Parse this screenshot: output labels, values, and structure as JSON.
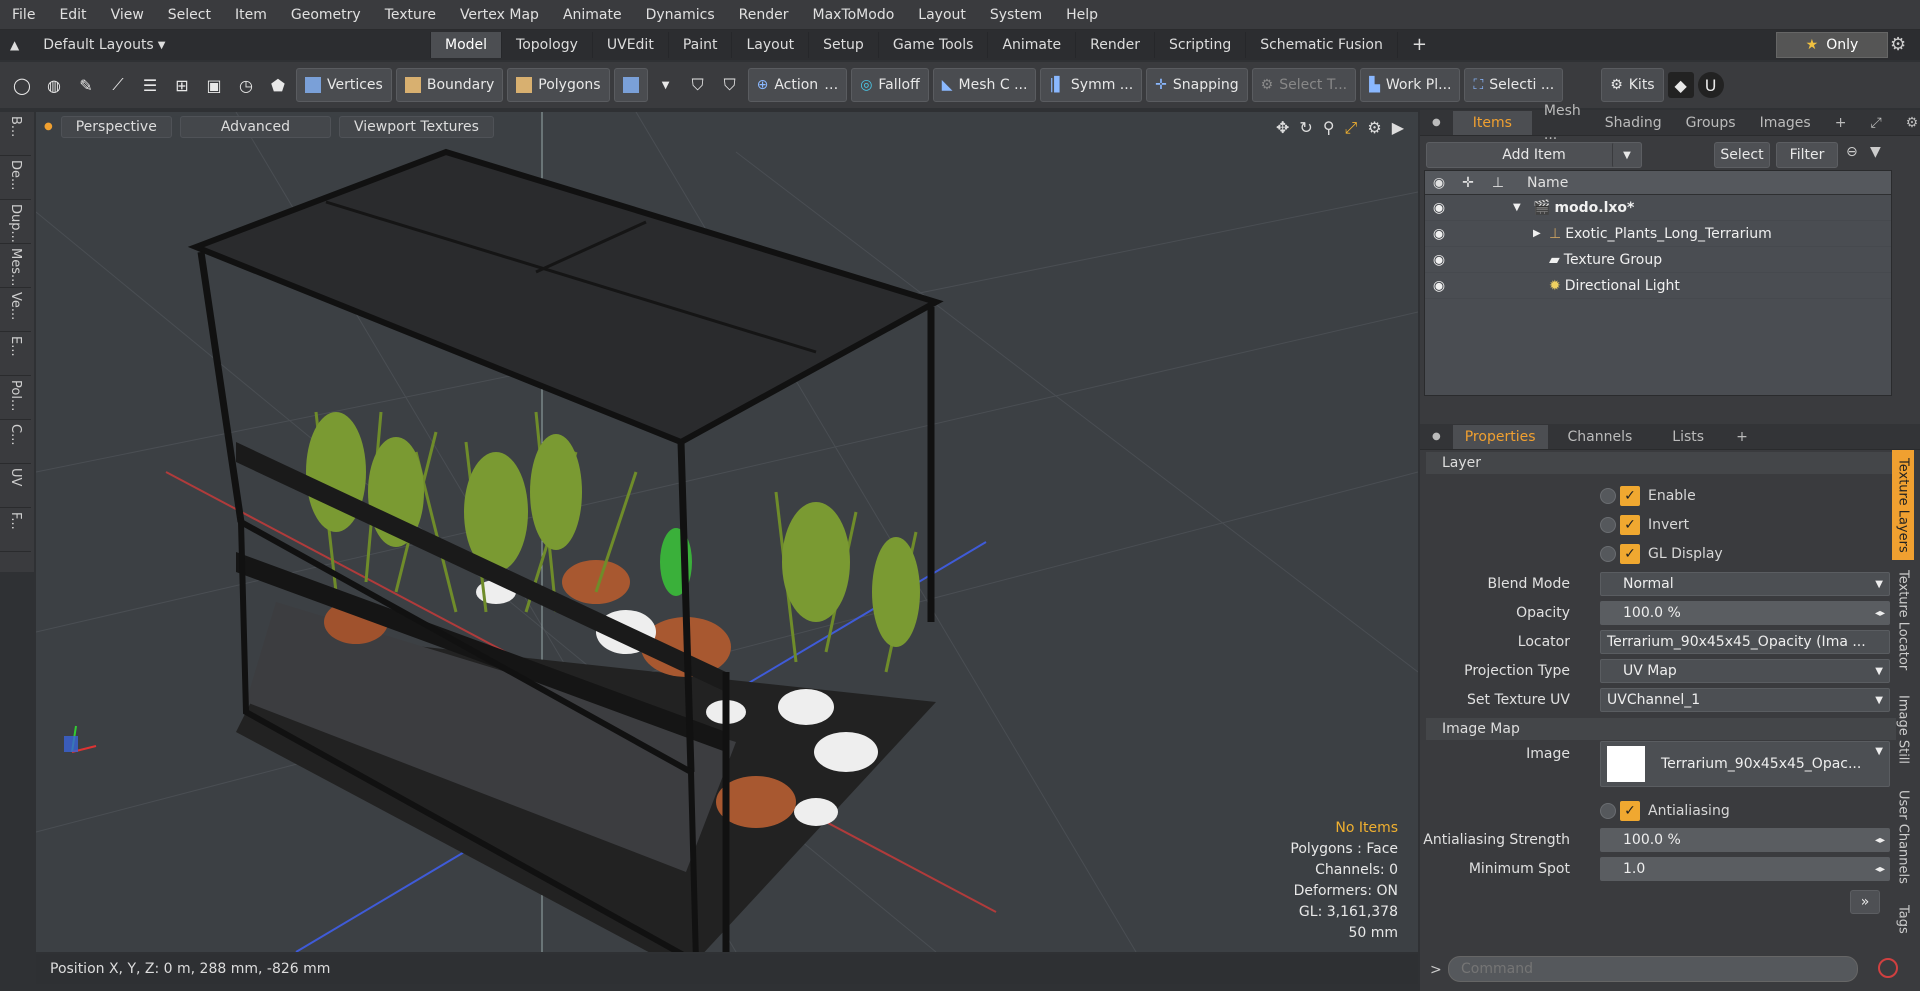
{
  "menu": [
    "File",
    "Edit",
    "View",
    "Select",
    "Item",
    "Geometry",
    "Texture",
    "Vertex Map",
    "Animate",
    "Dynamics",
    "Render",
    "MaxToModo",
    "Layout",
    "System",
    "Help"
  ],
  "layouts": {
    "label": "Default Layouts"
  },
  "layout_tabs": [
    "Model",
    "Topology",
    "UVEdit",
    "Paint",
    "Layout",
    "Setup",
    "Game Tools",
    "Animate",
    "Render",
    "Scripting",
    "Schematic Fusion"
  ],
  "only_label": "Only",
  "toolbar": {
    "vertices": "Vertices",
    "boundary": "Boundary",
    "polygons": "Polygons",
    "action": "Action",
    "falloff": "Falloff",
    "mesh": "Mesh C ...",
    "symm": "Symm ...",
    "snapping": "Snapping",
    "select_t": "Select T...",
    "work_pl": "Work Pl...",
    "selecti": "Selecti ...",
    "kits": "Kits"
  },
  "left_strip": [
    "B...",
    "De...",
    "Dup...",
    "Mes...",
    "Ve...",
    "E...",
    "Pol...",
    "C...",
    "UV",
    "F..."
  ],
  "viewport": {
    "tabs": [
      "Perspective",
      "Advanced",
      "Viewport Textures"
    ]
  },
  "hud": {
    "no_items": "No Items",
    "polygons": "Polygons : Face",
    "channels": "Channels: 0",
    "deformers": "Deformers: ON",
    "gl": "GL: 3,161,378",
    "size": "50 mm"
  },
  "status": {
    "position": "Position X, Y, Z:   0 m, 288 mm, -826 mm"
  },
  "items_panel": {
    "tabs": [
      "Items",
      "Mesh ...",
      "Shading",
      "Groups",
      "Images"
    ],
    "add_item": "Add Item",
    "select": "Select",
    "filter": "Filter",
    "name_header": "Name",
    "rows": [
      {
        "label": "modo.lxo*"
      },
      {
        "label": "Exotic_Plants_Long_Terrarium"
      },
      {
        "label": "Texture Group"
      },
      {
        "label": "Directional Light"
      }
    ]
  },
  "props_panel": {
    "tabs": [
      "Properties",
      "Channels",
      "Lists"
    ],
    "layer_section": "Layer",
    "enable": "Enable",
    "invert": "Invert",
    "gl_display": "GL Display",
    "blend_mode_label": "Blend Mode",
    "blend_mode": "Normal",
    "opacity_label": "Opacity",
    "opacity": "100.0 %",
    "locator_label": "Locator",
    "locator": "Terrarium_90x45x45_Opacity (Ima ...",
    "projection_label": "Projection Type",
    "projection": "UV Map",
    "texuv_label": "Set Texture UV",
    "texuv": "UVChannel_1",
    "image_map_section": "Image Map",
    "image_label": "Image",
    "image": "Terrarium_90x45x45_Opac...",
    "antialiasing": "Antialiasing",
    "aa_strength_label": "Antialiasing Strength",
    "aa_strength": "100.0 %",
    "min_spot_label": "Minimum Spot",
    "min_spot": "1.0",
    "side_tabs": [
      "Texture Layers",
      "Texture Locator",
      "Image Still",
      "User Channels",
      "Tags"
    ]
  },
  "command": {
    "placeholder": "Command"
  }
}
